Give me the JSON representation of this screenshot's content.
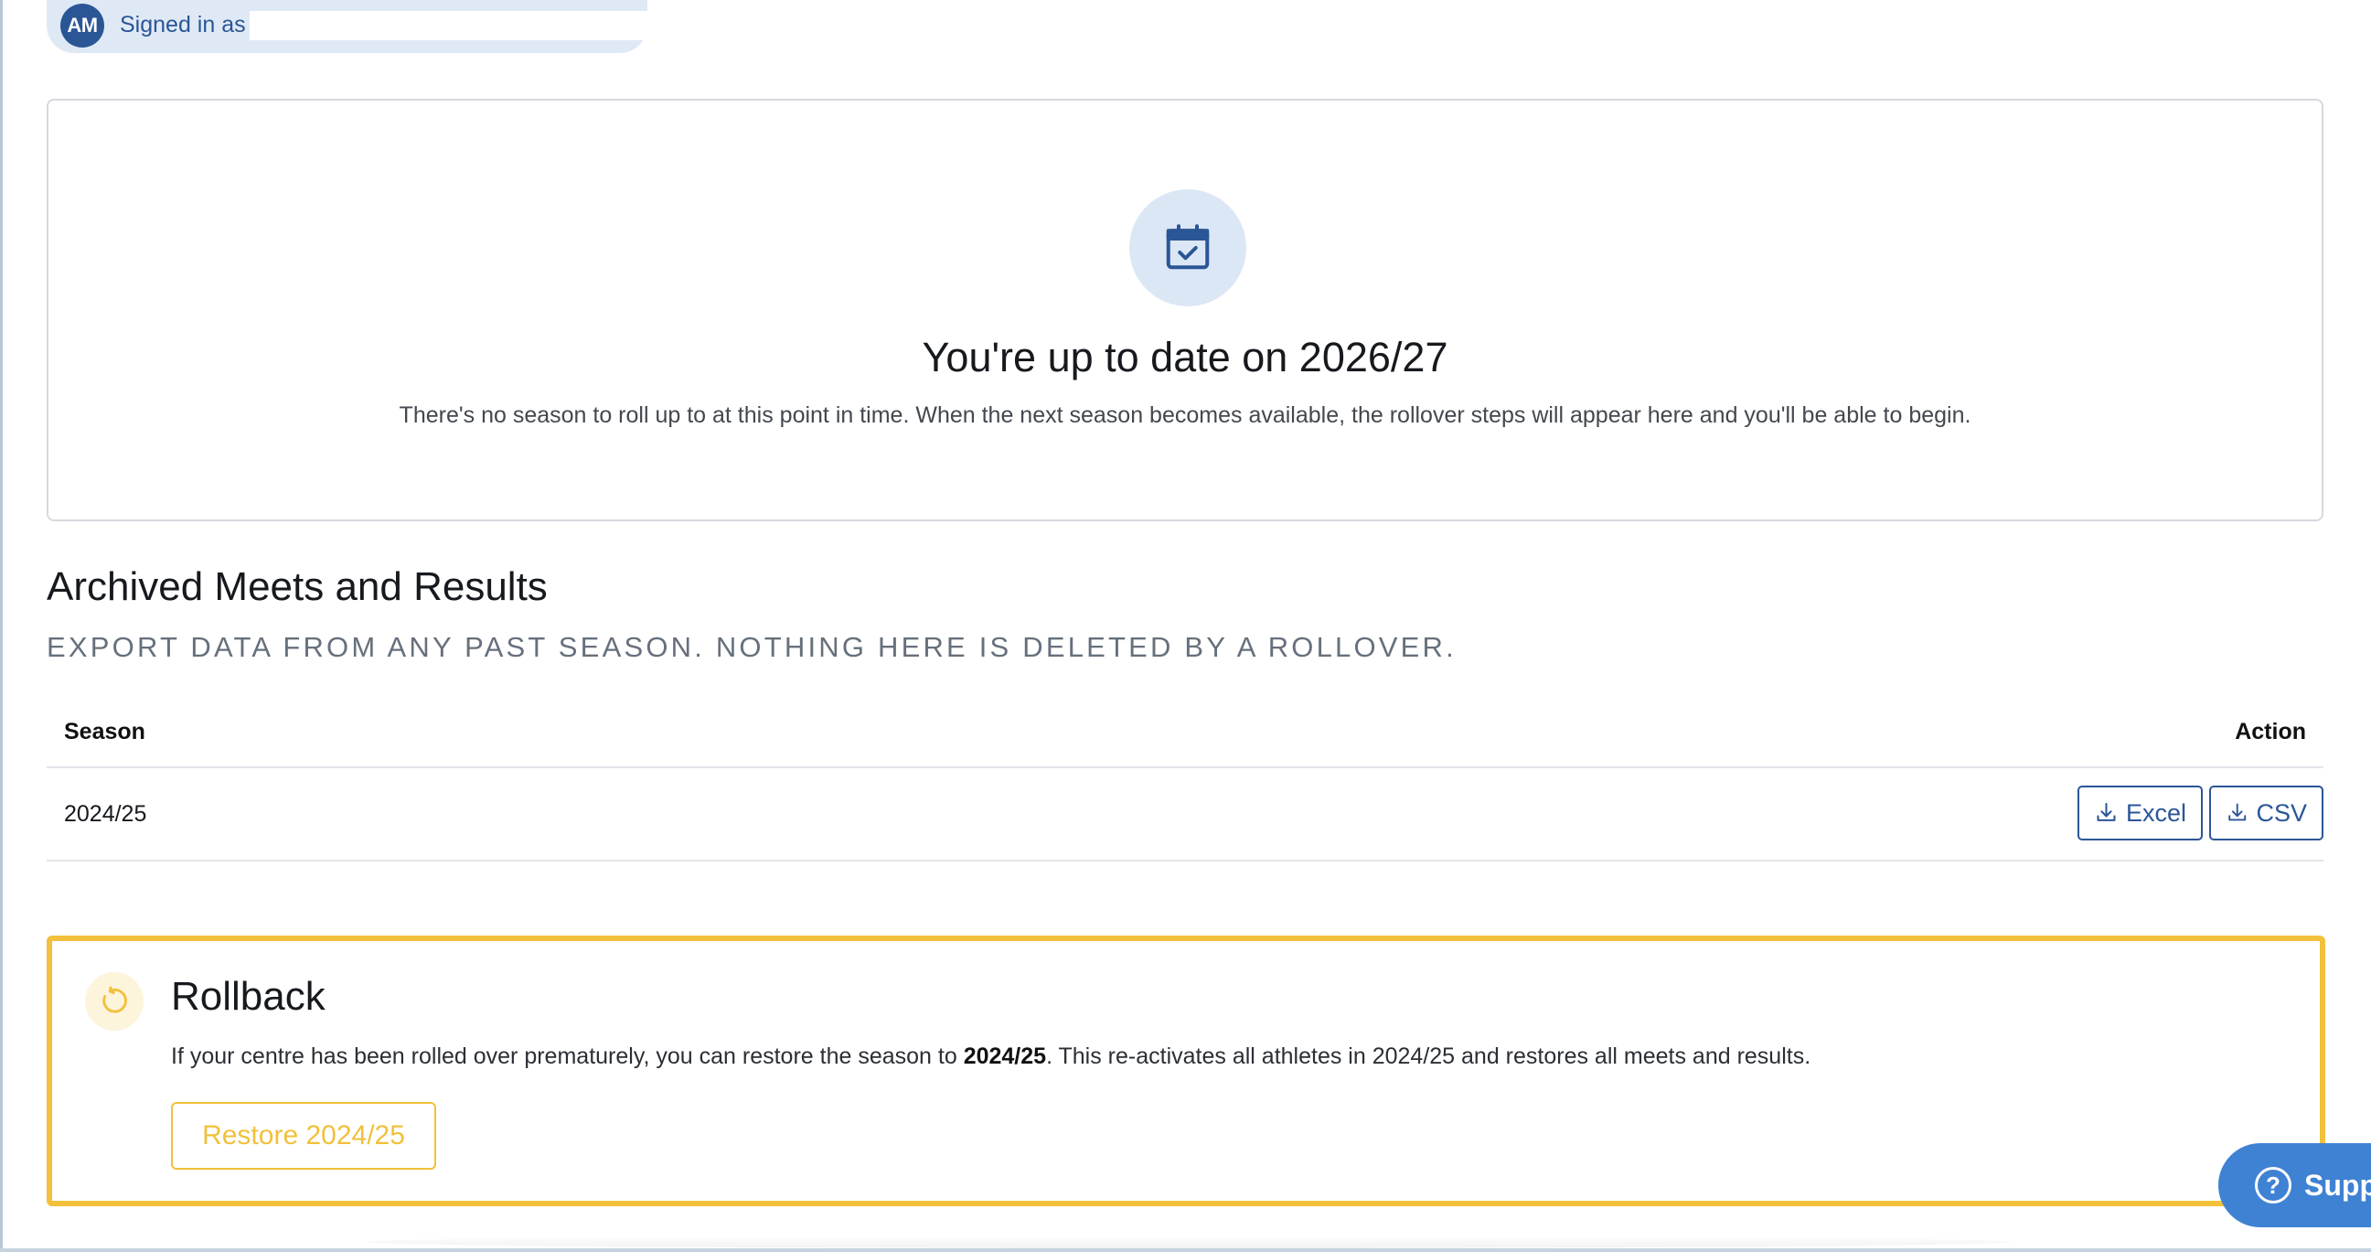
{
  "user": {
    "initials": "AM",
    "signed_in_label": "Signed in as"
  },
  "status": {
    "title": "You're up to date on 2026/27",
    "description": "There's no season to roll up to at this point in time. When the next season becomes available, the rollover steps will appear here and you'll be able to begin."
  },
  "archive": {
    "title": "Archived Meets and Results",
    "subtitle": "EXPORT DATA FROM ANY PAST SEASON. NOTHING HERE IS DELETED BY A ROLLOVER.",
    "columns": {
      "season": "Season",
      "action": "Action"
    },
    "rows": [
      {
        "season": "2024/25",
        "excel_label": "Excel",
        "csv_label": "CSV"
      }
    ]
  },
  "rollback": {
    "title": "Rollback",
    "desc_before": "If your centre has been rolled over prematurely, you can restore the season to ",
    "desc_season": "2024/25",
    "desc_after": ". This re-activates all athletes in 2024/25 and restores all meets and results.",
    "button_label": "Restore 2024/25"
  },
  "support": {
    "label": "Support",
    "icon": "question-icon"
  },
  "colors": {
    "primary": "#2a5696",
    "accent_warning": "#f2c03a",
    "support": "#3f82d3"
  }
}
